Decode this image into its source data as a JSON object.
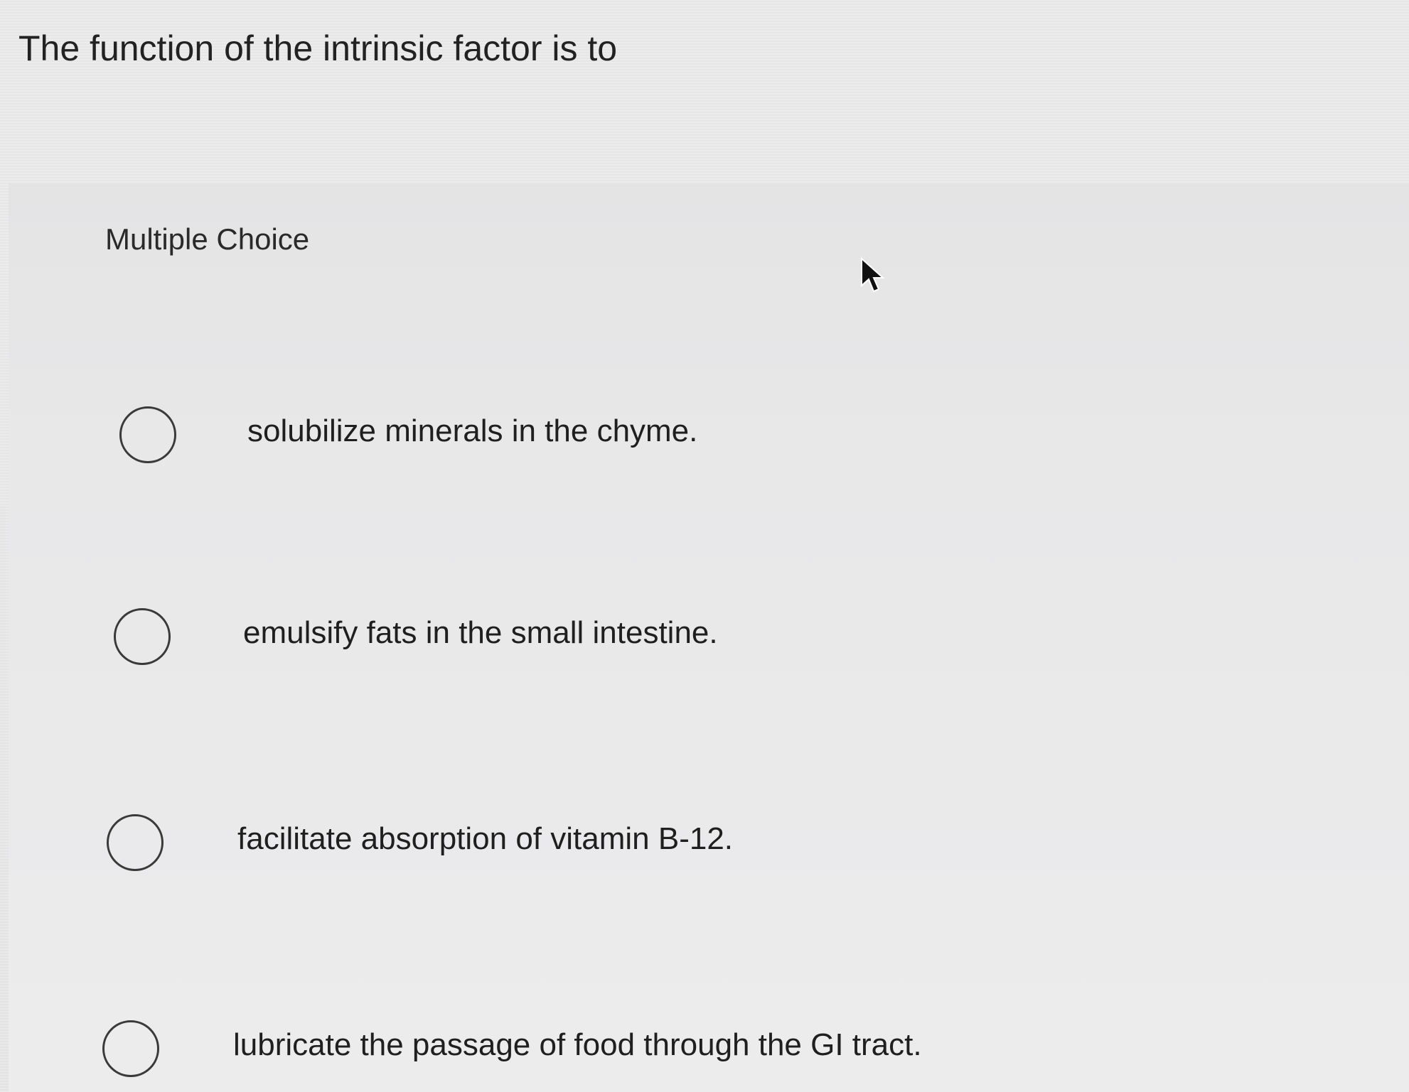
{
  "question": {
    "prompt": "The function of the intrinsic factor is to"
  },
  "multiple_choice": {
    "label": "Multiple Choice",
    "options": [
      {
        "text": "solubilize minerals in the chyme.",
        "selected": false
      },
      {
        "text": "emulsify fats in the small intestine.",
        "selected": false
      },
      {
        "text": "facilitate absorption of vitamin B-12.",
        "selected": false
      },
      {
        "text": "lubricate the passage of food through the GI tract.",
        "selected": false
      }
    ]
  },
  "icons": {
    "cursor": "mouse-pointer-icon",
    "radio": "radio-circle-icon"
  },
  "colors": {
    "background": "#e9e9ea",
    "text": "#1f1f1f",
    "radio_border": "#3a3a3a"
  }
}
